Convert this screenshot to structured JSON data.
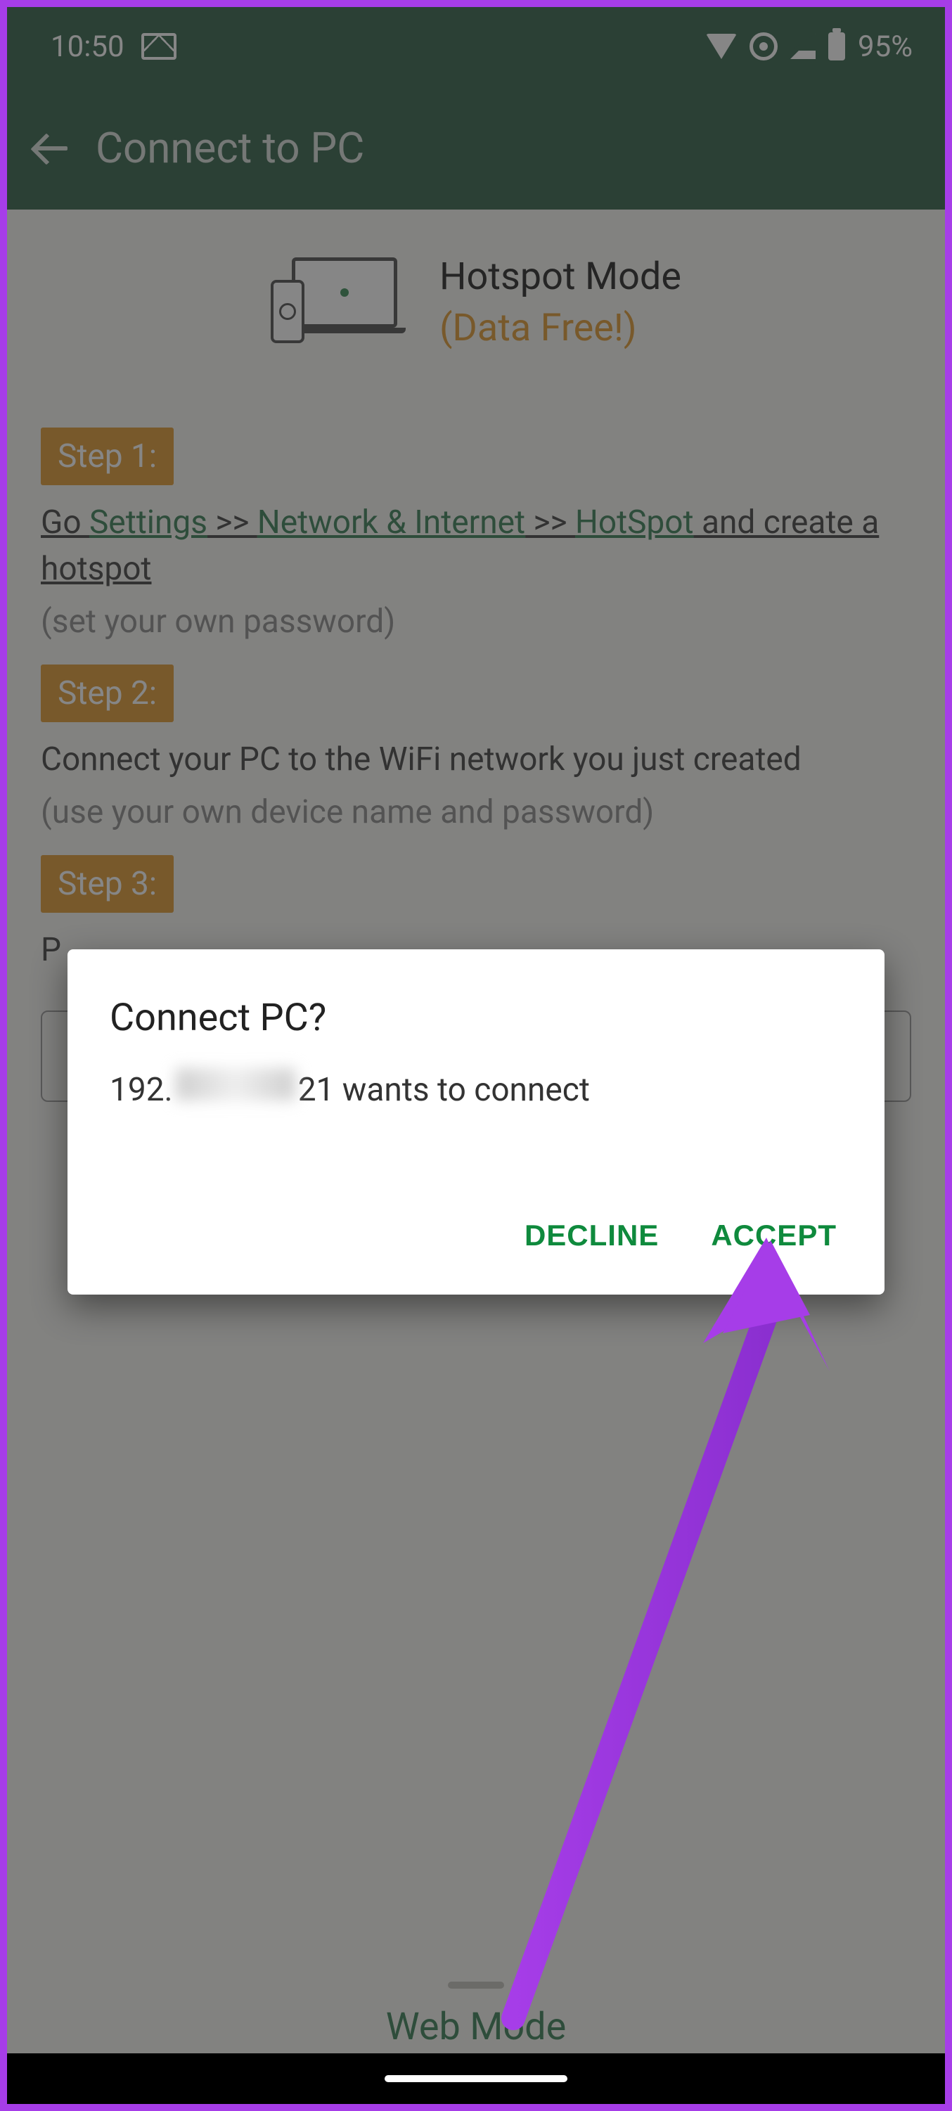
{
  "statusbar": {
    "time": "10:50",
    "battery": "95%"
  },
  "appbar": {
    "title": "Connect to PC"
  },
  "mode": {
    "title": "Hotspot Mode",
    "subtitle": "(Data Free!)"
  },
  "steps": {
    "s1_chip": "Step 1:",
    "s1_go": "Go ",
    "s1_settings": "Settings",
    "s1_sep1": " >> ",
    "s1_net": "Network & Internet",
    "s1_sep2": " >> ",
    "s1_hot": "HotSpot",
    "s1_tail": " and create a hotspot",
    "s1_note": "(set your own password)",
    "s2_chip": "Step 2:",
    "s2_text": "Connect your PC to the WiFi network you just created",
    "s2_note": "(use your own device name and password)",
    "s3_chip": "Step 3:",
    "s3_text_prefix": "P"
  },
  "web_mode": "Web Mode",
  "dialog": {
    "title": "Connect PC?",
    "ip_prefix": "192.",
    "ip_suffix": "21 wants to connect",
    "decline": "DECLINE",
    "accept": "ACCEPT"
  }
}
